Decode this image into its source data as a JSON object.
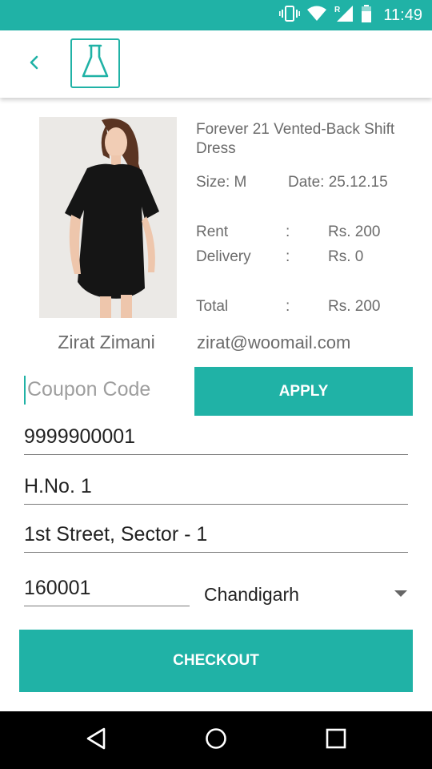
{
  "status_bar": {
    "time": "11:49",
    "icons": [
      "vibrate-icon",
      "wifi-icon",
      "signal-icon",
      "battery-icon"
    ],
    "background": "#20b2a6"
  },
  "app_bar": {
    "back_icon": "chevron-left-icon",
    "logo_icon": "flask-icon"
  },
  "product": {
    "title": "Forever 21 Vented-Back Shift Dress",
    "size": "Size: M",
    "date": "Date: 25.12.15",
    "image": "black-shift-dress-photo"
  },
  "pricing": {
    "rows": [
      {
        "label": "Rent",
        "colon": ":",
        "value": "Rs. 200"
      },
      {
        "label": "Delivery",
        "colon": ":",
        "value": "Rs. 0"
      },
      {
        "label": "Total",
        "colon": ":",
        "value": "Rs. 200"
      }
    ]
  },
  "customer": {
    "name": "Zirat Zimani",
    "email": "zirat@woomail.com"
  },
  "coupon": {
    "placeholder": "Coupon Code",
    "apply_label": "APPLY"
  },
  "form": {
    "phone": "9999900001",
    "house": "H.No. 1",
    "street": "1st Street, Sector - 1",
    "pincode": "160001",
    "city": "Chandigarh"
  },
  "checkout_label": "CHECKOUT",
  "nav_bar": {
    "icons": [
      "back-triangle-icon",
      "home-circle-icon",
      "recents-square-icon"
    ]
  },
  "colors": {
    "accent": "#20b2a6",
    "text_secondary": "#6b6b6b"
  }
}
